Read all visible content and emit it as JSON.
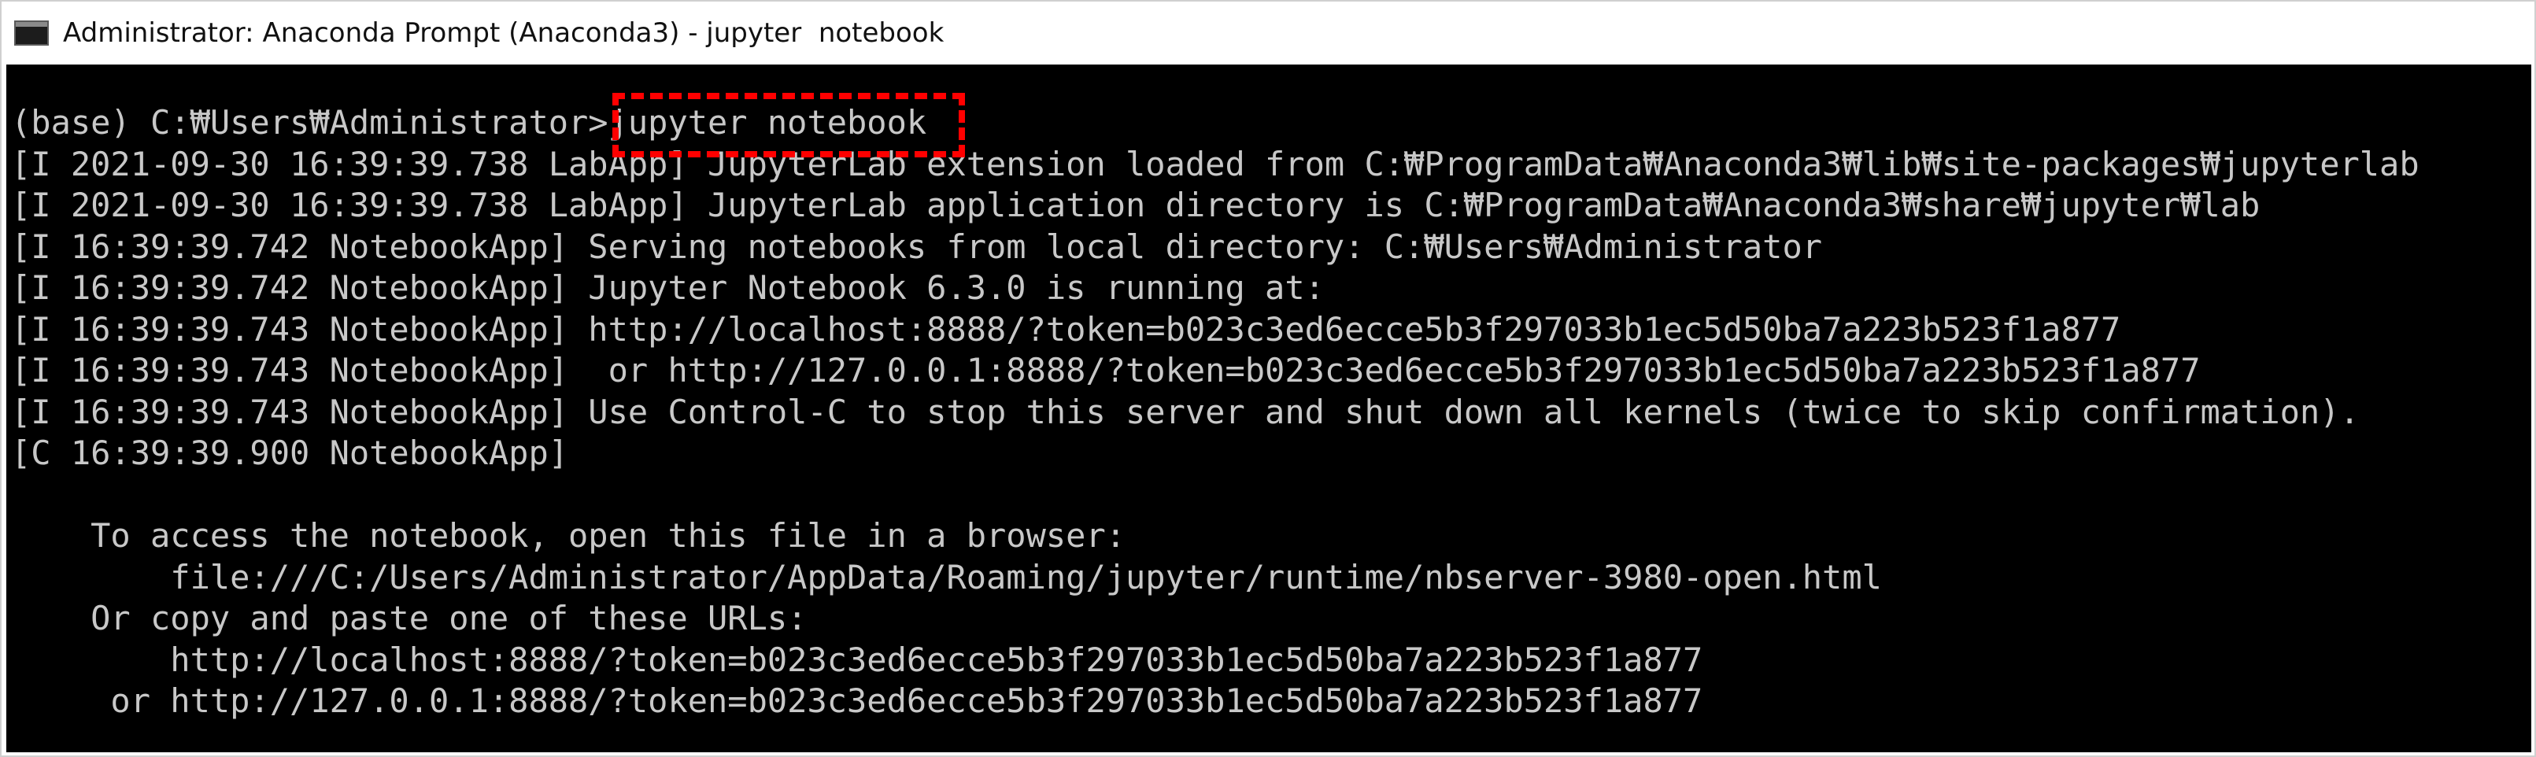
{
  "window": {
    "title": "Administrator: Anaconda Prompt (Anaconda3) - jupyter  notebook",
    "icon": "console-window-icon"
  },
  "console": {
    "lines": [
      "(base) C:₩Users₩Administrator>jupyter notebook",
      "[I 2021-09-30 16:39:39.738 LabApp] JupyterLab extension loaded from C:₩ProgramData₩Anaconda3₩lib₩site-packages₩jupyterlab",
      "[I 2021-09-30 16:39:39.738 LabApp] JupyterLab application directory is C:₩ProgramData₩Anaconda3₩share₩jupyter₩lab",
      "[I 16:39:39.742 NotebookApp] Serving notebooks from local directory: C:₩Users₩Administrator",
      "[I 16:39:39.742 NotebookApp] Jupyter Notebook 6.3.0 is running at:",
      "[I 16:39:39.743 NotebookApp] http://localhost:8888/?token=b023c3ed6ecce5b3f297033b1ec5d50ba7a223b523f1a877",
      "[I 16:39:39.743 NotebookApp]  or http://127.0.0.1:8888/?token=b023c3ed6ecce5b3f297033b1ec5d50ba7a223b523f1a877",
      "[I 16:39:39.743 NotebookApp] Use Control-C to stop this server and shut down all kernels (twice to skip confirmation).",
      "[C 16:39:39.900 NotebookApp]",
      "",
      "    To access the notebook, open this file in a browser:",
      "        file:///C:/Users/Administrator/AppData/Roaming/jupyter/runtime/nbserver-3980-open.html",
      "    Or copy and paste one of these URLs:",
      "        http://localhost:8888/?token=b023c3ed6ecce5b3f297033b1ec5d50ba7a223b523f1a877",
      "     or http://127.0.0.1:8888/?token=b023c3ed6ecce5b3f297033b1ec5d50ba7a223b523f1a877"
    ]
  },
  "colors": {
    "console_background": "#000000",
    "console_text": "#c8c8c8",
    "highlight": "#ff0000",
    "titlebar_background": "#ffffff"
  }
}
